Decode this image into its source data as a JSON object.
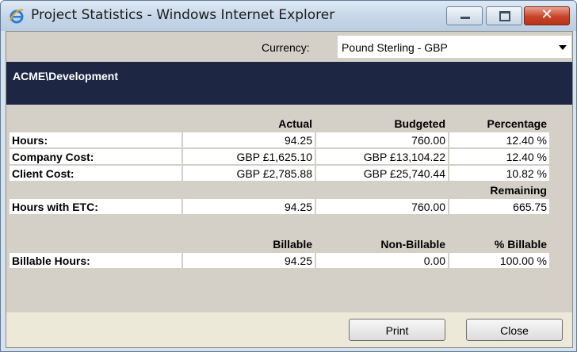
{
  "window": {
    "title": "Project Statistics - Windows Internet Explorer",
    "icon": "ie-icon"
  },
  "currency": {
    "label": "Currency:",
    "selected": "Pound Sterling - GBP"
  },
  "header": {
    "text": "ACME\\Development"
  },
  "table": {
    "headers1": [
      "Actual",
      "Budgeted",
      "Percentage"
    ],
    "rows1": [
      {
        "label": "Hours:",
        "actual": "94.25",
        "budgeted": "760.00",
        "percentage": "12.40 %"
      },
      {
        "label": "Company Cost:",
        "actual": "GBP £1,625.10",
        "budgeted": "GBP £13,104.22",
        "percentage": "12.40 %"
      },
      {
        "label": "Client Cost:",
        "actual": "GBP £2,785.88",
        "budgeted": "GBP £25,740.44",
        "percentage": "10.82 %"
      }
    ],
    "remaining_header": "Remaining",
    "etc_row": {
      "label": "Hours with ETC:",
      "actual": "94.25",
      "budgeted": "760.00",
      "remaining": "665.75"
    },
    "headers2": [
      "Billable",
      "Non-Billable",
      "% Billable"
    ],
    "billable_row": {
      "label": "Billable Hours:",
      "billable": "94.25",
      "non_billable": "0.00",
      "pct": "100.00 %"
    }
  },
  "buttons": {
    "print": "Print",
    "close": "Close"
  }
}
